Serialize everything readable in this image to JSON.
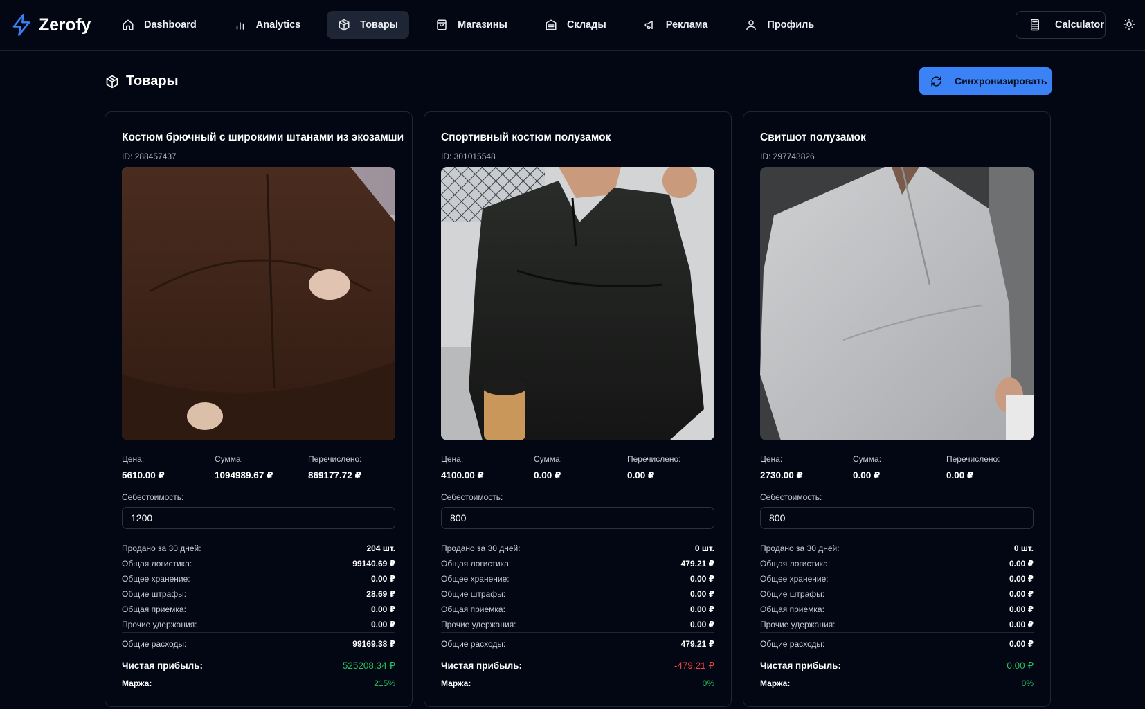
{
  "app": {
    "name": "Zerofy"
  },
  "nav": {
    "items": [
      {
        "label": "Dashboard",
        "icon": "home-icon",
        "active": false
      },
      {
        "label": "Analytics",
        "icon": "bar-chart-icon",
        "active": false
      },
      {
        "label": "Товары",
        "icon": "package-icon",
        "active": true
      },
      {
        "label": "Магазины",
        "icon": "shopping-bag-icon",
        "active": false
      },
      {
        "label": "Склады",
        "icon": "warehouse-icon",
        "active": false
      },
      {
        "label": "Реклама",
        "icon": "megaphone-icon",
        "active": false
      },
      {
        "label": "Профиль",
        "icon": "user-icon",
        "active": false
      }
    ],
    "calculator_label": "Calculator",
    "theme_icon": "sun-icon"
  },
  "page": {
    "title": "Товары",
    "sync_label": "Синхронизировать"
  },
  "colors": {
    "accent": "#3b82f6",
    "positive": "#22c55e",
    "negative": "#ef4444",
    "background": "#030713"
  },
  "labels": {
    "price": "Цена:",
    "sum": "Сумма:",
    "transferred": "Перечислено:",
    "cost": "Себестоимость:",
    "sold_30": "Продано за 30 дней:",
    "logistics": "Общая логистика:",
    "storage": "Общее хранение:",
    "fines": "Общие штрафы:",
    "acceptance": "Общая приемка:",
    "other": "Прочие удержания:",
    "total_expenses": "Общие расходы:",
    "net_profit": "Чистая прибыль:",
    "margin": "Маржа:"
  },
  "products": [
    {
      "title": "Костюм брючный с широкими штанами из экозамши",
      "id": "ID: 288457437",
      "image": "brown-suit-photo",
      "price": "5610.00 ₽",
      "sum": "1094989.67 ₽",
      "transferred": "869177.72 ₽",
      "cost": "1200",
      "sold_30": "204 шт.",
      "logistics": "99140.69 ₽",
      "storage": "0.00 ₽",
      "fines": "28.69 ₽",
      "acceptance": "0.00 ₽",
      "other": "0.00 ₽",
      "total_expenses": "99169.38 ₽",
      "net_profit": "525208.34 ₽",
      "margin": "215%",
      "profit_sign": "positive"
    },
    {
      "title": "Спортивный костюм полузамок",
      "id": "ID: 301015548",
      "image": "black-tracksuit-photo",
      "price": "4100.00 ₽",
      "sum": "0.00 ₽",
      "transferred": "0.00 ₽",
      "cost": "800",
      "sold_30": "0 шт.",
      "logistics": "479.21 ₽",
      "storage": "0.00 ₽",
      "fines": "0.00 ₽",
      "acceptance": "0.00 ₽",
      "other": "0.00 ₽",
      "total_expenses": "479.21 ₽",
      "net_profit": "-479.21 ₽",
      "margin": "0%",
      "profit_sign": "negative"
    },
    {
      "title": "Свитшот полузамок",
      "id": "ID: 297743826",
      "image": "grey-sweatshirt-photo",
      "price": "2730.00 ₽",
      "sum": "0.00 ₽",
      "transferred": "0.00 ₽",
      "cost": "800",
      "sold_30": "0 шт.",
      "logistics": "0.00 ₽",
      "storage": "0.00 ₽",
      "fines": "0.00 ₽",
      "acceptance": "0.00 ₽",
      "other": "0.00 ₽",
      "total_expenses": "0.00 ₽",
      "net_profit": "0.00 ₽",
      "margin": "0%",
      "profit_sign": "positive"
    }
  ]
}
